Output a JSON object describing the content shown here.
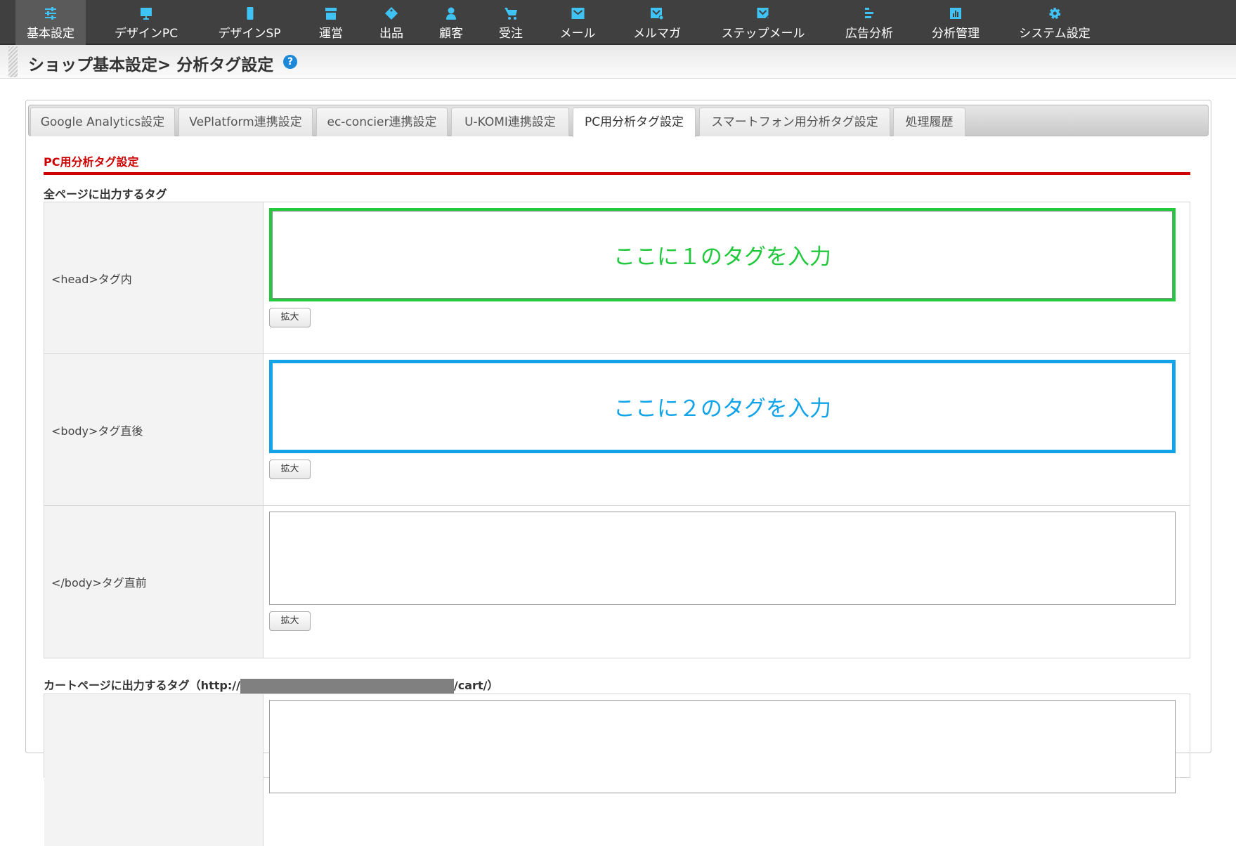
{
  "nav": [
    {
      "label": "基本設定",
      "icon": "sliders-icon",
      "active": true
    },
    {
      "label": "デザインPC",
      "icon": "monitor-icon"
    },
    {
      "label": "デザインSP",
      "icon": "smartphone-icon"
    },
    {
      "label": "運営",
      "icon": "store-icon"
    },
    {
      "label": "出品",
      "icon": "tag-icon"
    },
    {
      "label": "顧客",
      "icon": "user-icon"
    },
    {
      "label": "受注",
      "icon": "cart-icon"
    },
    {
      "label": "メール",
      "icon": "mail-icon"
    },
    {
      "label": "メルマガ",
      "icon": "newsletter-icon"
    },
    {
      "label": "ステップメール",
      "icon": "step-mail-icon"
    },
    {
      "label": "広告分析",
      "icon": "bars-icon"
    },
    {
      "label": "分析管理",
      "icon": "chart-icon"
    },
    {
      "label": "システム設定",
      "icon": "gear-icon"
    }
  ],
  "page_title": "ショップ基本設定> 分析タグ設定",
  "help": "?",
  "tabs": [
    "Google Analytics設定",
    "VePlatform連携設定",
    "ec-concier連携設定",
    "U-KOMI連携設定",
    "PC用分析タグ設定",
    "スマートフォン用分析タグ設定",
    "処理履歴"
  ],
  "active_tab": "PC用分析タグ設定",
  "section_title": "PC用分析タグ設定",
  "all_pages": {
    "heading": "全ページに出力するタグ",
    "rows": [
      {
        "label": "<head>タグ内",
        "overlay": "ここに１のタグを入力",
        "button": "拡大"
      },
      {
        "label": "<body>タグ直後",
        "overlay": "ここに２のタグを入力",
        "button": "拡大"
      },
      {
        "label": "</body>タグ直前",
        "overlay": "",
        "button": "拡大"
      }
    ]
  },
  "cart": {
    "heading_prefix": "カートページに出力するタグ（http://",
    "heading_suffix": "/cart/）"
  },
  "colors": {
    "nav_bg": "#404040",
    "icon": "#3fc3f5",
    "accent_red": "#cc0000",
    "highlight_green": "#22c93c",
    "highlight_blue": "#12a4e8"
  }
}
